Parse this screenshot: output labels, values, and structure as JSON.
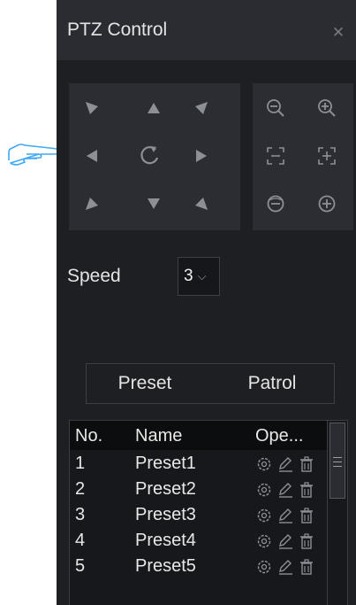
{
  "panel": {
    "title": "PTZ Control",
    "close_icon": "close-icon"
  },
  "pointer": {
    "icon": "pointing-hand-icon"
  },
  "direction_pad": {
    "buttons": [
      {
        "name": "up-left",
        "icon": "arrow-up-left-icon"
      },
      {
        "name": "up",
        "icon": "arrow-up-icon"
      },
      {
        "name": "up-right",
        "icon": "arrow-up-right-icon"
      },
      {
        "name": "left",
        "icon": "arrow-left-icon"
      },
      {
        "name": "auto-rotate",
        "icon": "rotate-icon"
      },
      {
        "name": "right",
        "icon": "arrow-right-icon"
      },
      {
        "name": "down-left",
        "icon": "arrow-down-left-icon"
      },
      {
        "name": "down",
        "icon": "arrow-down-icon"
      },
      {
        "name": "down-right",
        "icon": "arrow-down-right-icon"
      }
    ]
  },
  "lens_pad": {
    "buttons": [
      {
        "name": "zoom-out",
        "icon": "zoom-out-icon"
      },
      {
        "name": "zoom-in",
        "icon": "zoom-in-icon"
      },
      {
        "name": "focus-far",
        "icon": "focus-minus-icon"
      },
      {
        "name": "focus-near",
        "icon": "focus-plus-icon"
      },
      {
        "name": "iris-close",
        "icon": "iris-minus-icon"
      },
      {
        "name": "iris-open",
        "icon": "iris-plus-icon"
      }
    ]
  },
  "speed": {
    "label": "Speed",
    "value": "3"
  },
  "tabs": [
    {
      "label": "Preset"
    },
    {
      "label": "Patrol"
    }
  ],
  "preset_table": {
    "columns": [
      "No.",
      "Name",
      "Ope..."
    ],
    "rows": [
      {
        "no": "1",
        "name": "Preset1"
      },
      {
        "no": "2",
        "name": "Preset2"
      },
      {
        "no": "3",
        "name": "Preset3"
      },
      {
        "no": "4",
        "name": "Preset4"
      },
      {
        "no": "5",
        "name": "Preset5"
      }
    ],
    "operation_icons": [
      "settings-icon",
      "edit-icon",
      "delete-icon"
    ]
  },
  "colors": {
    "panel_bg": "#1e1f23",
    "header_bg": "#2a2c32",
    "pad_bg": "#2b2d33",
    "icon_gray": "#8c8f95",
    "text": "#e4e4e4"
  }
}
